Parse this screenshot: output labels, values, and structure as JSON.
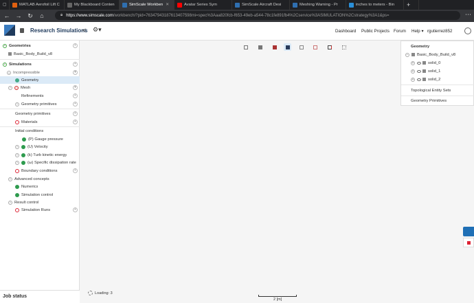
{
  "browser": {
    "tabs": [
      {
        "label": "MATLAB Aerofoil Lift C",
        "color": "#e06010"
      },
      {
        "label": "My Blackboard Conten",
        "color": "#444444"
      },
      {
        "label": "SimScale Workben",
        "color": "#2f6fb0",
        "active": true
      },
      {
        "label": "Avatar Series Sym",
        "color": "#ff0000"
      },
      {
        "label": "SimScale Aircraft Desi",
        "color": "#2f6fb0"
      },
      {
        "label": "Meshing Warning - Pr",
        "color": "#2f6fb0"
      },
      {
        "label": "inches to meters - Bin",
        "color": "#2a8fd8"
      }
    ],
    "url_host": "https://www.simscale.com",
    "url_path": "/workbench/?pid=76347943187613407598mi=spec%3Aaa820fcb-f653-49eb-a544-78c1fe891fb4%2Cservice%3ASIMULATION%2Cstrategy%3A1&ps="
  },
  "header": {
    "project_title": "Research Simulations",
    "links": [
      "Dashboard",
      "Public Projects",
      "Forum",
      "Help ▾",
      "rgutierrez852"
    ]
  },
  "left_tree": {
    "geometries_label": "Geometries",
    "geometry_item": "Basic_Body_Build_v8",
    "simulations_label": "Simulations",
    "incompressible": "Incompressible",
    "geometry": "Geometry",
    "mesh": "Mesh",
    "refinements": "Refinements",
    "geometry_primitives_sub": "Geometry primitives",
    "geometry_primitives": "Geometry primitives",
    "materials": "Materials",
    "initial_conditions": "Initial conditions",
    "gauge_pressure": "(P) Gauge pressure",
    "velocity": "(U) Velocity",
    "turb_ke": "(k) Turb kinetic energy",
    "dissipation": "(ω) Specific dissipation rate",
    "boundary_conditions": "Boundary conditions",
    "advanced_concepts": "Advanced concepts",
    "numerics": "Numerics",
    "simulation_control": "Simulation control",
    "result_control": "Result control",
    "simulation_runs": "Simulation Runs"
  },
  "job_status": "Job status",
  "right_panel": {
    "geometry_label": "Geometry",
    "body": "Basic_Body_Build_v8",
    "solids": [
      "solid_0",
      "solid_1",
      "solid_2"
    ],
    "topological": "Topological Entity Sets",
    "primitives": "Geometry Primitives"
  },
  "viewer": {
    "loading": "Loading: 3",
    "scale": "2 [m]"
  }
}
